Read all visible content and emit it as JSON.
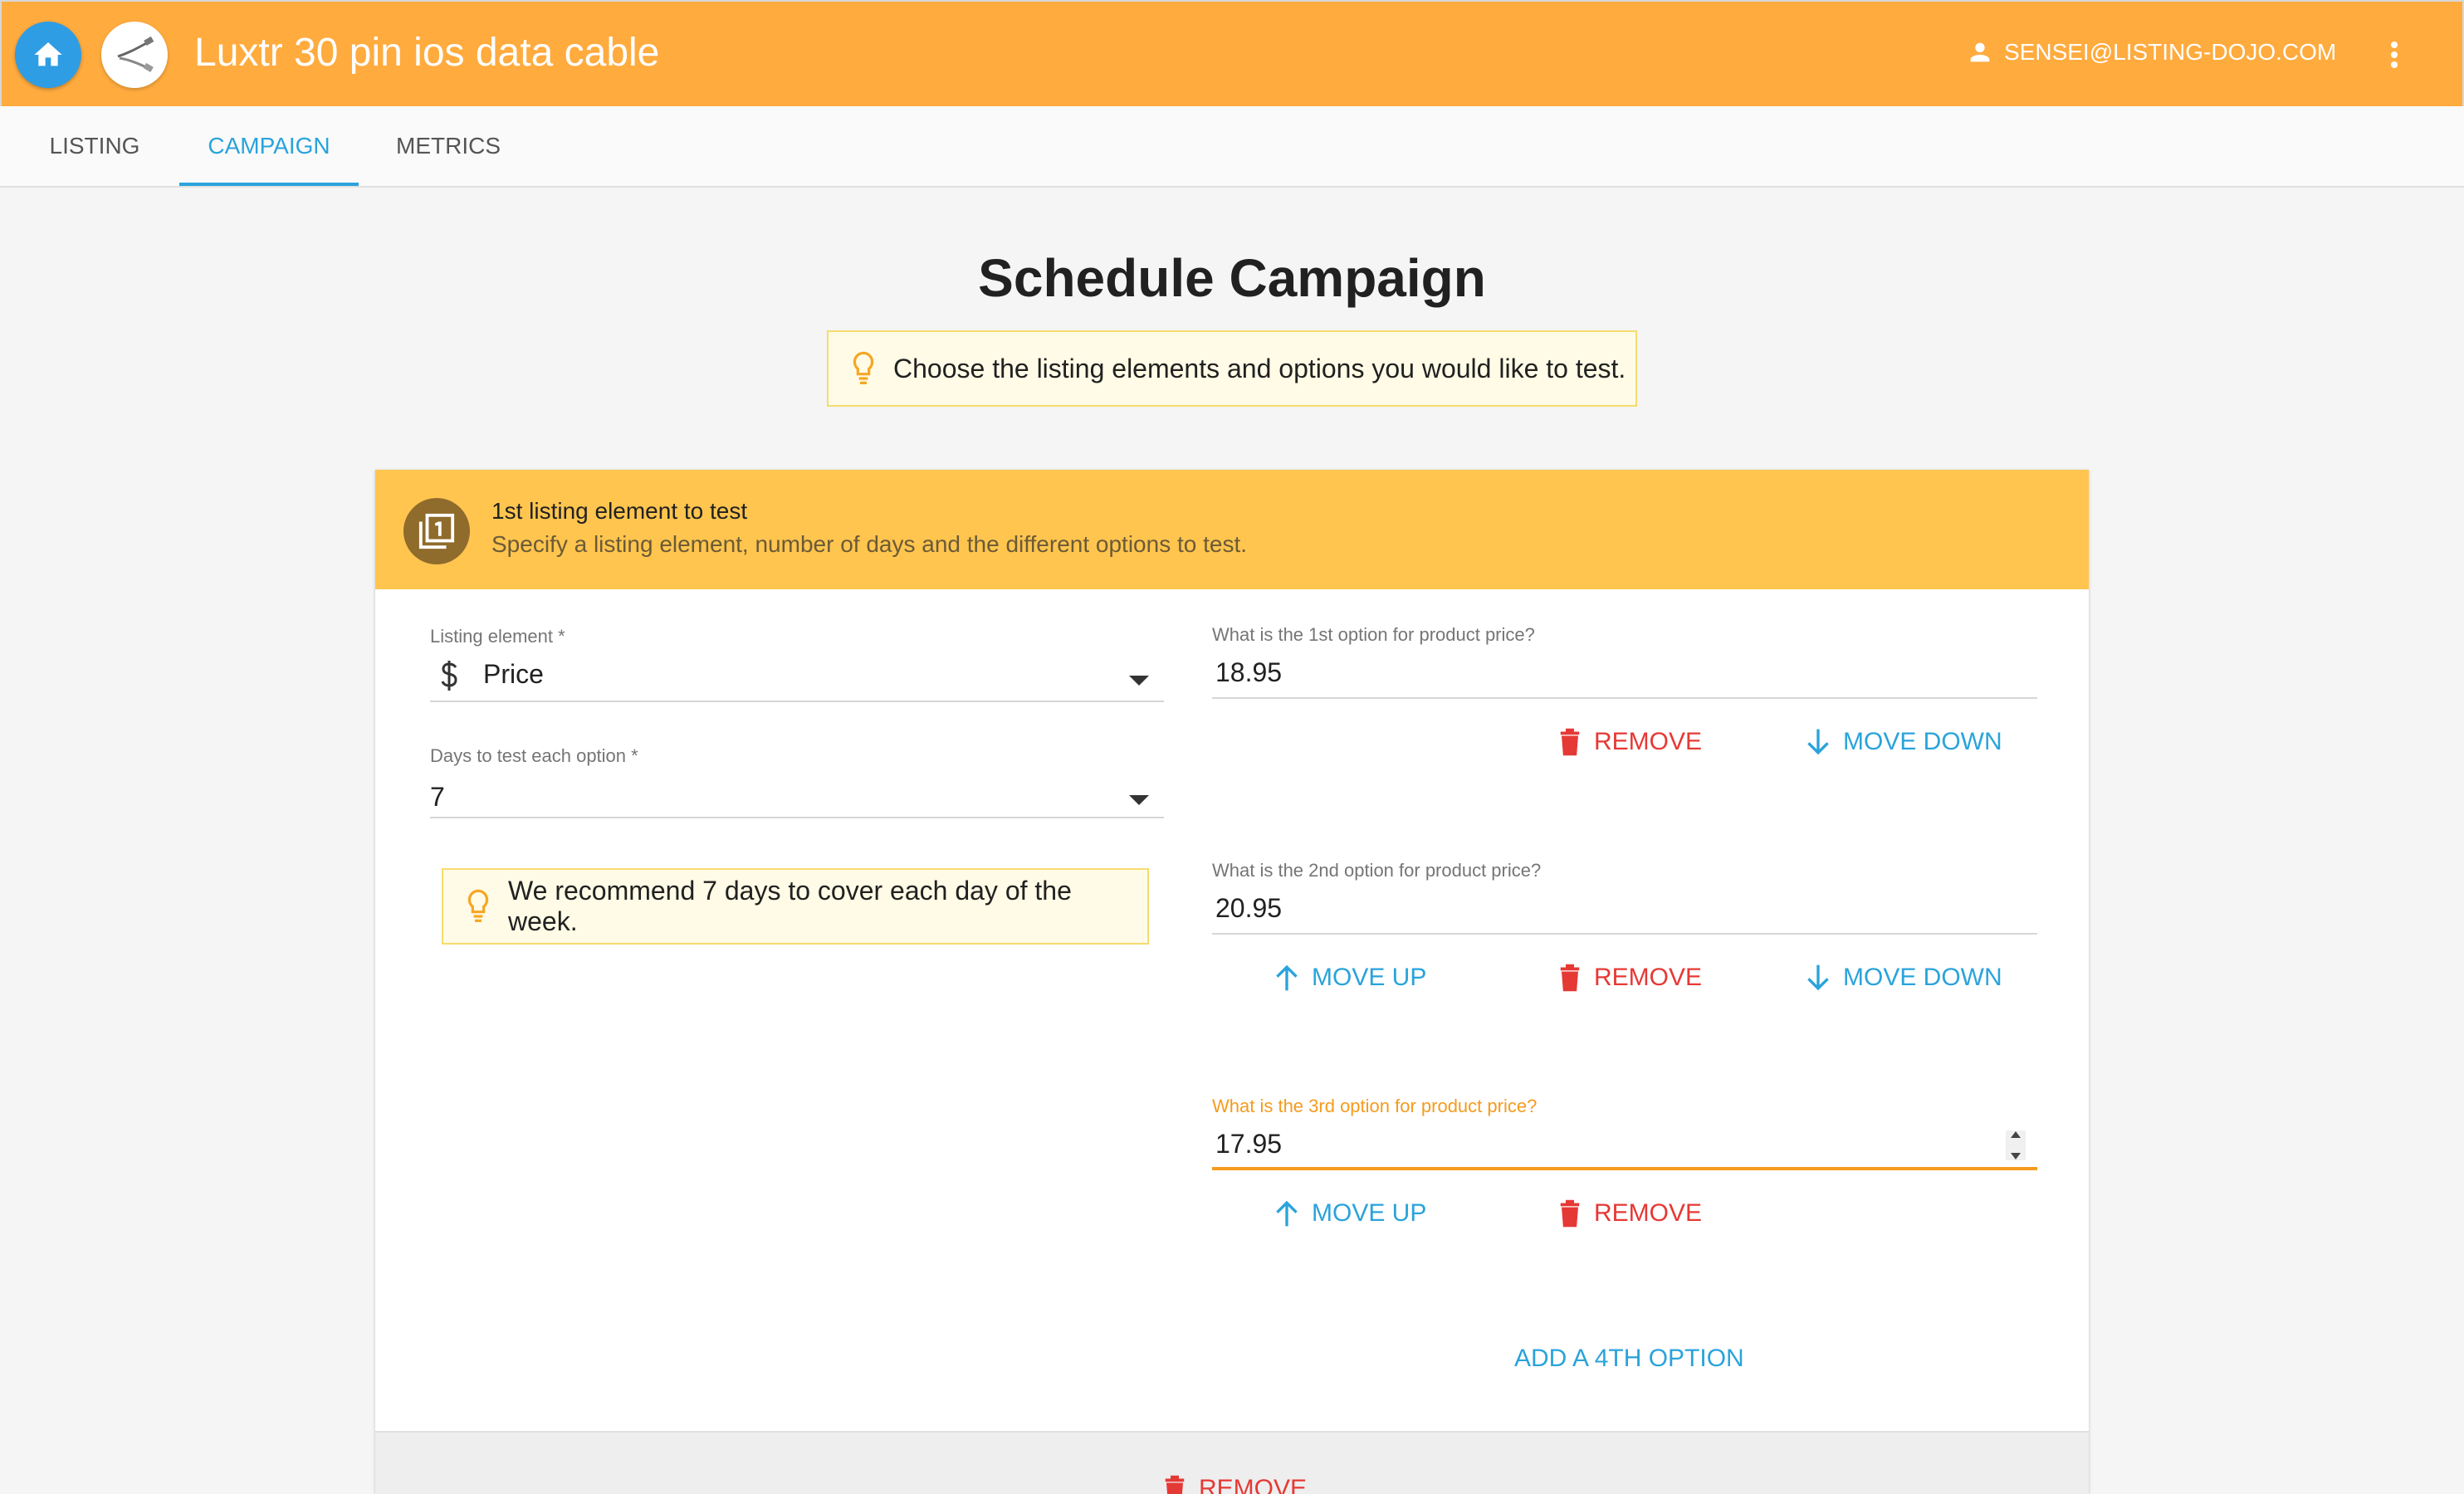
{
  "app": {
    "title": "Luxtr 30 pin ios data cable",
    "user_email": "SENSEI@LISTING-DOJO.COM",
    "accent_color": "#ffab3e",
    "home_icon": "home-icon",
    "menu_icon": "more-vert-icon"
  },
  "tabs": [
    {
      "label": "LISTING",
      "active": false
    },
    {
      "label": "CAMPAIGN",
      "active": true
    },
    {
      "label": "METRICS",
      "active": false
    }
  ],
  "main": {
    "title": "Schedule Campaign",
    "tip": "Choose the listing elements and options you would like to test."
  },
  "card": {
    "step_title": "1st listing element to test",
    "step_subtitle": "Specify a listing element, number of days and the different options to test.",
    "listing_element": {
      "label": "Listing element *",
      "value": "Price",
      "icon": "dollar-icon"
    },
    "days": {
      "label": "Days to test each option *",
      "value": "7"
    },
    "days_tip": "We recommend 7 days to cover each day of the week.",
    "options": [
      {
        "label": "What is the 1st option for product price?",
        "value": "18.95"
      },
      {
        "label": "What is the 2nd option for product price?",
        "value": "20.95"
      },
      {
        "label": "What is the 3rd option for product price?",
        "value": "17.95",
        "focused": true
      }
    ],
    "actions": {
      "remove": "REMOVE",
      "move_up": "MOVE UP",
      "move_down": "MOVE DOWN"
    },
    "add_option": "ADD A 4TH OPTION",
    "footer_remove": "REMOVE"
  },
  "colors": {
    "primary": "#2aa3db",
    "danger": "#e53935",
    "focus": "#f59b1e",
    "header": "#ffc54f"
  }
}
